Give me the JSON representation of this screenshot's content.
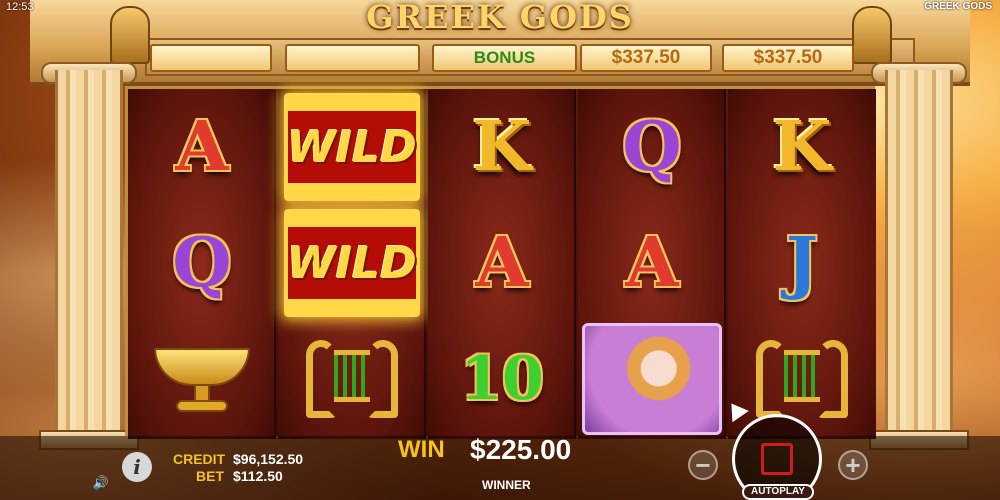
{
  "header": {
    "clock": "12:53",
    "title": "GREEK GODS",
    "game_name": "GREEK GODS"
  },
  "top_boxes": {
    "bonus_label": "BONUS",
    "prize_1": "$337.50",
    "prize_2": "$337.50"
  },
  "reels": [
    [
      "A",
      "Q",
      "cup"
    ],
    [
      "WILD",
      "WILD",
      "lyre"
    ],
    [
      "K",
      "A",
      "10"
    ],
    [
      "Q",
      "A",
      "goddess"
    ],
    [
      "K",
      "J",
      "lyre"
    ]
  ],
  "symbols": {
    "wild_label": "WILD"
  },
  "bottom": {
    "credit_label": "CREDIT",
    "credit_value": "$96,152.50",
    "bet_label": "BET",
    "bet_value": "$112.50",
    "win_label": "WIN",
    "win_value": "$225.00",
    "winner_label": "WINNER",
    "minus_label": "−",
    "plus_label": "+",
    "autoplay_label": "AUTOPLAY",
    "info_label": "i",
    "sound_label": "🔊"
  },
  "colors": {
    "accent_gold": "#f7c21a",
    "spin_red": "#d31b1b",
    "bonus_green": "#2f8a1a"
  }
}
